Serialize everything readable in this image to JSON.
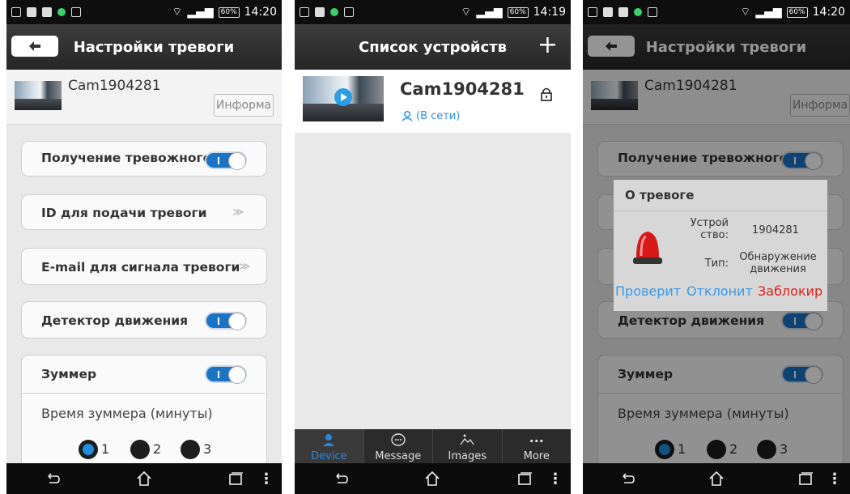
{
  "status": {
    "p1_time": "14:20",
    "p2_time": "14:19",
    "p3_time": "14:20",
    "battery": "60%"
  },
  "colors": {
    "accent": "#1b73c6",
    "link": "#2f8fe6",
    "red": "#e02020"
  },
  "screen1": {
    "title": "Настройки тревоги",
    "cam_name": "Cam1904281",
    "info_button": "Информа",
    "items": [
      {
        "label": "Получение тревожного",
        "type": "toggle"
      },
      {
        "label": "ID для подачи тревоги",
        "type": "arrow"
      },
      {
        "label": "E-mail для сигнала тревоги",
        "type": "arrow"
      },
      {
        "label": "Детектор движения",
        "type": "toggle"
      },
      {
        "label": "Зуммер",
        "type": "toggle"
      }
    ],
    "buzzer_time_label": "Время зуммера (минуты)",
    "radio_options": [
      "1",
      "2",
      "3"
    ],
    "radio_selected": "1"
  },
  "screen2": {
    "title": "Список устройств",
    "add_icon": "+",
    "device_name": "Cam1904281",
    "device_status": "(В сети)",
    "tabs": [
      {
        "label": "Device",
        "icon": "person-icon"
      },
      {
        "label": "Message",
        "icon": "message-icon"
      },
      {
        "label": "Images",
        "icon": "image-icon"
      },
      {
        "label": "More",
        "icon": "more-icon"
      }
    ],
    "more_dots": "..."
  },
  "screen3": {
    "dialog_title": "О тревоге",
    "device_label": "Устрой ство:",
    "device_value": "1904281",
    "type_label": "Тип:",
    "type_value": "Обнаружение движения",
    "btn_check": "Проверит",
    "btn_decline": "Отклонит",
    "btn_block": "Заблокир"
  }
}
